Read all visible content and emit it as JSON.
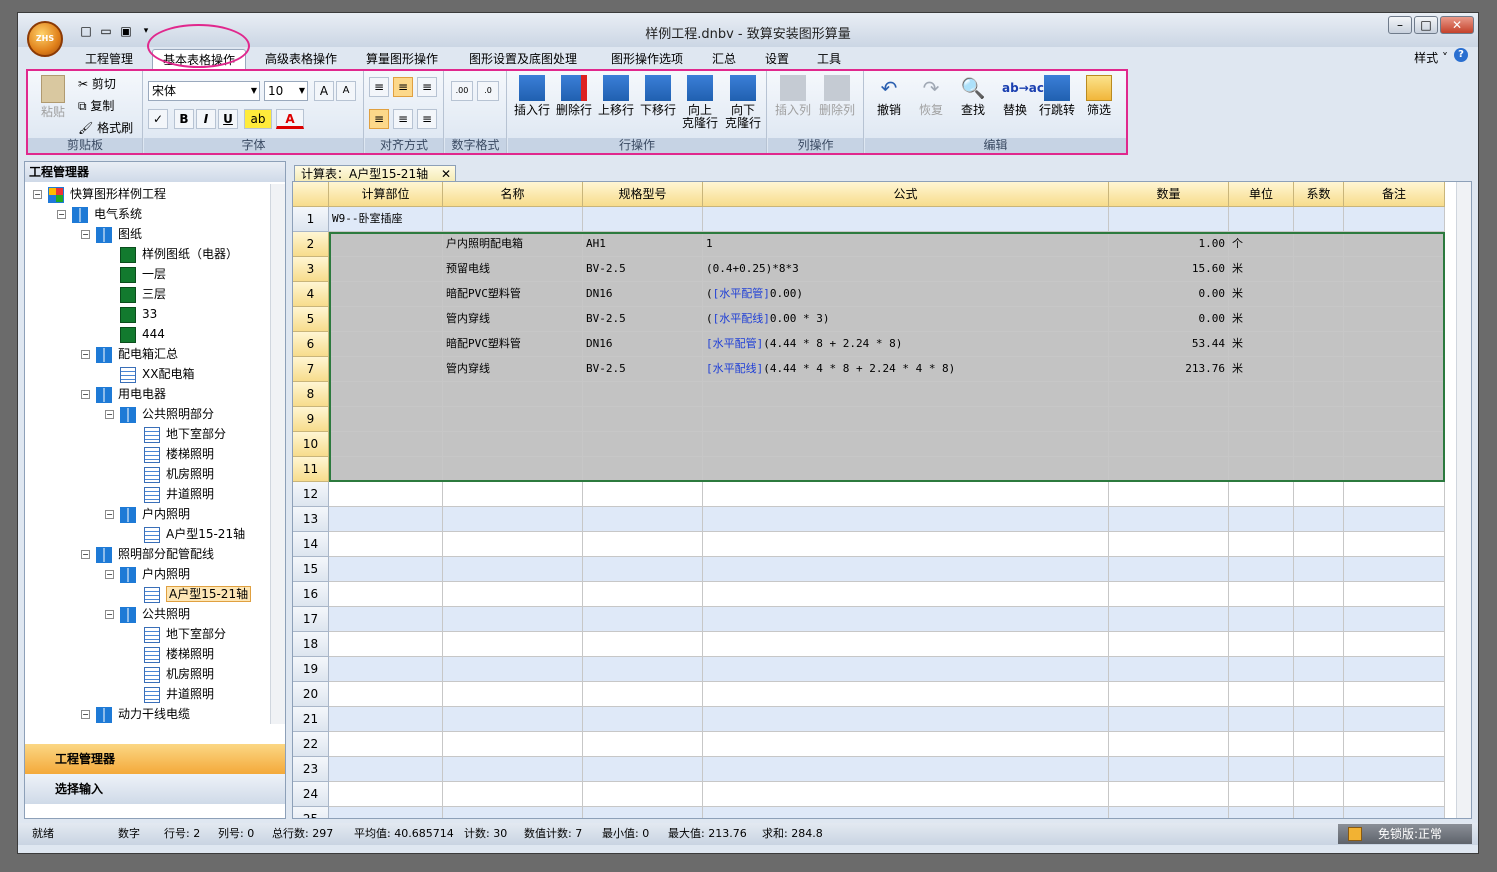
{
  "window": {
    "title": "样例工程.dnbv - 致算安装图形算量",
    "logo_text": "ZHS"
  },
  "menu": {
    "tabs": [
      "工程管理",
      "基本表格操作",
      "高级表格操作",
      "算量图形操作",
      "图形设置及底图处理",
      "图形操作选项",
      "汇总",
      "设置",
      "工具"
    ],
    "style_label": "样式"
  },
  "ribbon": {
    "clipboard": {
      "paste": "粘贴",
      "cut": "剪切",
      "copy": "复制",
      "format_painter": "格式刷",
      "label": "剪贴板"
    },
    "font": {
      "name": "宋体",
      "size": "10",
      "label": "字体"
    },
    "align": {
      "label": "对齐方式"
    },
    "number": {
      "label": "数字格式"
    },
    "rows": {
      "insert": "插入行",
      "delete": "删除行",
      "up": "上移行",
      "down": "下移行",
      "clone_up": "向上\n克隆行",
      "clone_down": "向下\n克隆行",
      "label": "行操作"
    },
    "cols": {
      "insert": "插入列",
      "delete": "删除列",
      "label": "列操作"
    },
    "edit": {
      "undo": "撤销",
      "redo": "恢复",
      "find": "查找",
      "replace": "替换",
      "jump": "行跳转",
      "filter": "筛选",
      "label": "编辑"
    }
  },
  "left_panel": {
    "title": "工程管理器",
    "tree": [
      {
        "label": "快算图形样例工程",
        "level": 0,
        "icon": "project",
        "exp": "-"
      },
      {
        "label": "电气系统",
        "level": 1,
        "icon": "folder",
        "exp": "-"
      },
      {
        "label": "图纸",
        "level": 2,
        "icon": "folder",
        "exp": "-"
      },
      {
        "label": "样例图纸（电器）",
        "level": 3,
        "icon": "dwg",
        "exp": ""
      },
      {
        "label": "一层",
        "level": 3,
        "icon": "dwg",
        "exp": ""
      },
      {
        "label": "三层",
        "level": 3,
        "icon": "dwg",
        "exp": ""
      },
      {
        "label": "33",
        "level": 3,
        "icon": "dwg",
        "exp": ""
      },
      {
        "label": "444",
        "level": 3,
        "icon": "dwg",
        "exp": ""
      },
      {
        "label": "配电箱汇总",
        "level": 2,
        "icon": "folder",
        "exp": "-"
      },
      {
        "label": "XX配电箱",
        "level": 3,
        "icon": "sheet",
        "exp": ""
      },
      {
        "label": "用电电器",
        "level": 2,
        "icon": "folder",
        "exp": "-"
      },
      {
        "label": "公共照明部分",
        "level": 3,
        "icon": "folder",
        "exp": "-"
      },
      {
        "label": "地下室部分",
        "level": 4,
        "icon": "sheet",
        "exp": ""
      },
      {
        "label": "楼梯照明",
        "level": 4,
        "icon": "sheet",
        "exp": ""
      },
      {
        "label": "机房照明",
        "level": 4,
        "icon": "sheet",
        "exp": ""
      },
      {
        "label": "井道照明",
        "level": 4,
        "icon": "sheet",
        "exp": ""
      },
      {
        "label": "户内照明",
        "level": 3,
        "icon": "folder",
        "exp": "-"
      },
      {
        "label": "A户型15-21轴",
        "level": 4,
        "icon": "sheet",
        "exp": ""
      },
      {
        "label": "照明部分配管配线",
        "level": 2,
        "icon": "folder",
        "exp": "-"
      },
      {
        "label": "户内照明",
        "level": 3,
        "icon": "folder",
        "exp": "-"
      },
      {
        "label": "A户型15-21轴",
        "level": 4,
        "icon": "sheet",
        "exp": "",
        "selected": true
      },
      {
        "label": "公共照明",
        "level": 3,
        "icon": "folder",
        "exp": "-"
      },
      {
        "label": "地下室部分",
        "level": 4,
        "icon": "sheet",
        "exp": ""
      },
      {
        "label": "楼梯照明",
        "level": 4,
        "icon": "sheet",
        "exp": ""
      },
      {
        "label": "机房照明",
        "level": 4,
        "icon": "sheet",
        "exp": ""
      },
      {
        "label": "井道照明",
        "level": 4,
        "icon": "sheet",
        "exp": ""
      },
      {
        "label": "动力干线电缆",
        "level": 2,
        "icon": "folder",
        "exp": "-"
      }
    ],
    "nav_manager": "工程管理器",
    "nav_select": "选择输入"
  },
  "doc_tab": {
    "label": "计算表：A户型15-21轴"
  },
  "grid": {
    "columns": [
      "计算部位",
      "名称",
      "规格型号",
      "公式",
      "数量",
      "单位",
      "系数",
      "备注"
    ],
    "rows": [
      {
        "n": "1",
        "part": "W9--卧室插座",
        "name": "",
        "spec": "",
        "formula": "",
        "formula_pre": "",
        "formula_post": "",
        "qty": "",
        "unit": ""
      },
      {
        "n": "2",
        "part": "",
        "name": "户内照明配电箱",
        "spec": "AH1",
        "formula_pre": "",
        "formula": "",
        "formula_post": "1",
        "qty": "1.00",
        "unit": "个"
      },
      {
        "n": "3",
        "part": "",
        "name": "预留电线",
        "spec": "BV-2.5",
        "formula_pre": "",
        "formula": "",
        "formula_post": "(0.4+0.25)*8*3",
        "qty": "15.60",
        "unit": "米"
      },
      {
        "n": "4",
        "part": "",
        "name": "暗配PVC塑料管",
        "spec": "DN16",
        "formula_pre": "(",
        "formula": "[水平配管]",
        "formula_post": "0.00)",
        "qty": "0.00",
        "unit": "米"
      },
      {
        "n": "5",
        "part": "",
        "name": "管内穿线",
        "spec": "BV-2.5",
        "formula_pre": "(",
        "formula": "[水平配线]",
        "formula_post": "0.00 * 3)",
        "qty": "0.00",
        "unit": "米"
      },
      {
        "n": "6",
        "part": "",
        "name": "暗配PVC塑料管",
        "spec": "DN16",
        "formula_pre": "",
        "formula": "[水平配管]",
        "formula_post": "(4.44 * 8 + 2.24 * 8)",
        "qty": "53.44",
        "unit": "米"
      },
      {
        "n": "7",
        "part": "",
        "name": "管内穿线",
        "spec": "BV-2.5",
        "formula_pre": "",
        "formula": "[水平配线]",
        "formula_post": "(4.44 * 4 * 8 + 2.24 * 4 * 8)",
        "qty": "213.76",
        "unit": "米"
      },
      {
        "n": "8"
      },
      {
        "n": "9"
      },
      {
        "n": "10"
      },
      {
        "n": "11"
      },
      {
        "n": "12"
      },
      {
        "n": "13"
      },
      {
        "n": "14"
      },
      {
        "n": "15"
      },
      {
        "n": "16"
      },
      {
        "n": "17"
      },
      {
        "n": "18"
      },
      {
        "n": "19"
      },
      {
        "n": "20"
      },
      {
        "n": "21"
      },
      {
        "n": "22"
      },
      {
        "n": "23"
      },
      {
        "n": "24"
      },
      {
        "n": "25"
      }
    ]
  },
  "status": {
    "ready": "就绪",
    "mode": "数字",
    "row": "行号: 2",
    "col": "列号: 0",
    "total_rows": "总行数: 297",
    "avg": "平均值: 40.685714",
    "count": "计数: 30",
    "num_count": "数值计数: 7",
    "min": "最小值: 0",
    "max": "最大值: 213.76",
    "sum": "求和: 284.8",
    "edition": "免锁版:正常"
  },
  "colors": {
    "accent_highlight": "#e0288d",
    "selection_fill": "#c3c3c3",
    "alt_row": "#dfe9f8",
    "formula_blue": "#1f3fd6"
  }
}
